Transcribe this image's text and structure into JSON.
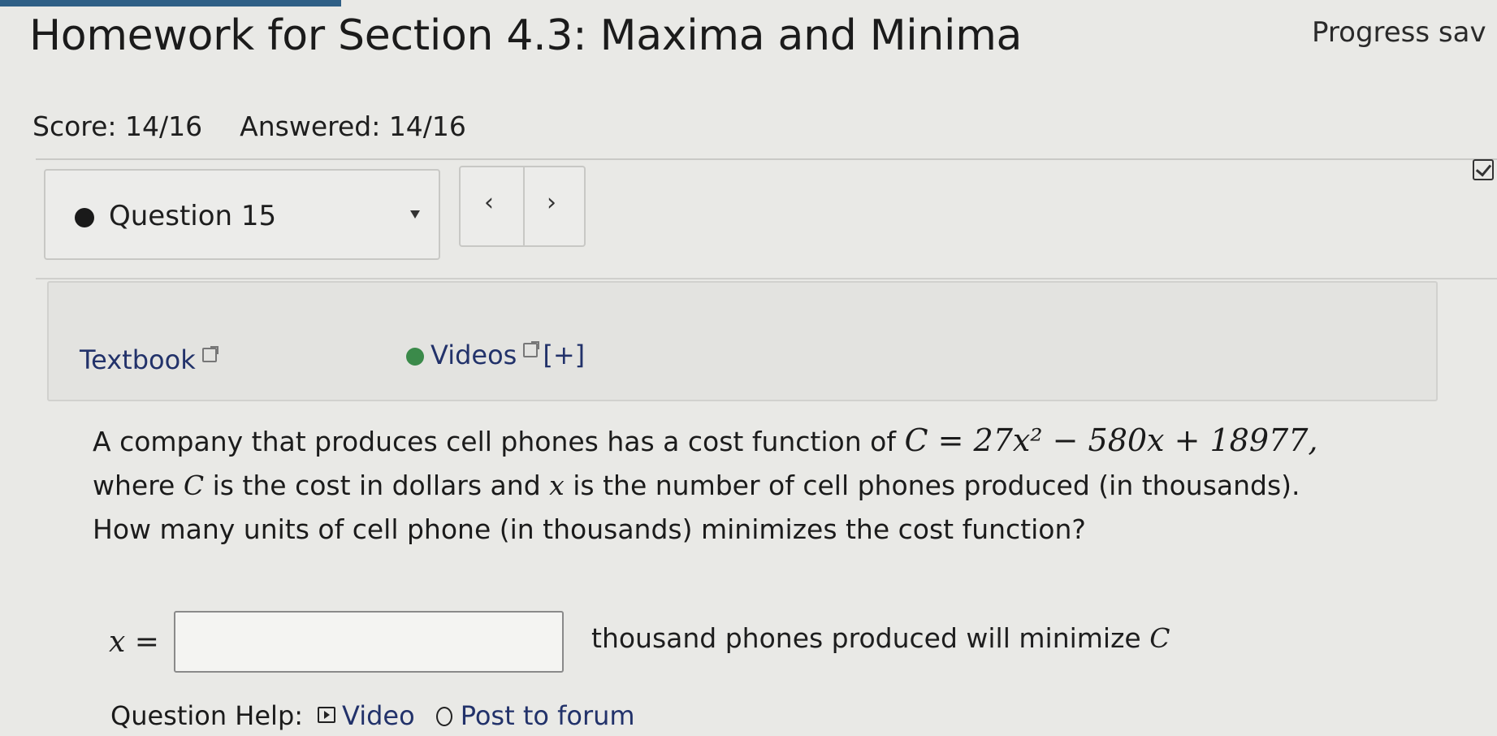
{
  "header": {
    "title": "Homework for Section 4.3: Maxima and Minima",
    "progress_text": "Progress sav",
    "score": "Score: 14/16",
    "answered": "Answered: 14/16"
  },
  "question_nav": {
    "question_label": "Question 15",
    "prev_glyph": "‹",
    "next_glyph": "›"
  },
  "help_links": {
    "textbook": "Textbook",
    "videos": "Videos",
    "videos_expand": "[+]"
  },
  "problem": {
    "line1_text": "A company that produces cell phones has a cost function of ",
    "equation": "C = 27x² − 580x + 18977,",
    "line2_pre": "where ",
    "line2_var_c": "C",
    "line2_mid": " is the cost in dollars and ",
    "line2_var_x": "x",
    "line2_post": " is the number of cell phones produced (in thousands).",
    "line3": "How many units of cell phone (in thousands) minimizes the cost function?"
  },
  "answer": {
    "lhs": "x =",
    "value": "",
    "suffix_text": "thousand phones produced will minimize ",
    "suffix_var": "C"
  },
  "question_help": {
    "label": "Question Help:",
    "video": "Video",
    "forum": "Post to forum"
  }
}
